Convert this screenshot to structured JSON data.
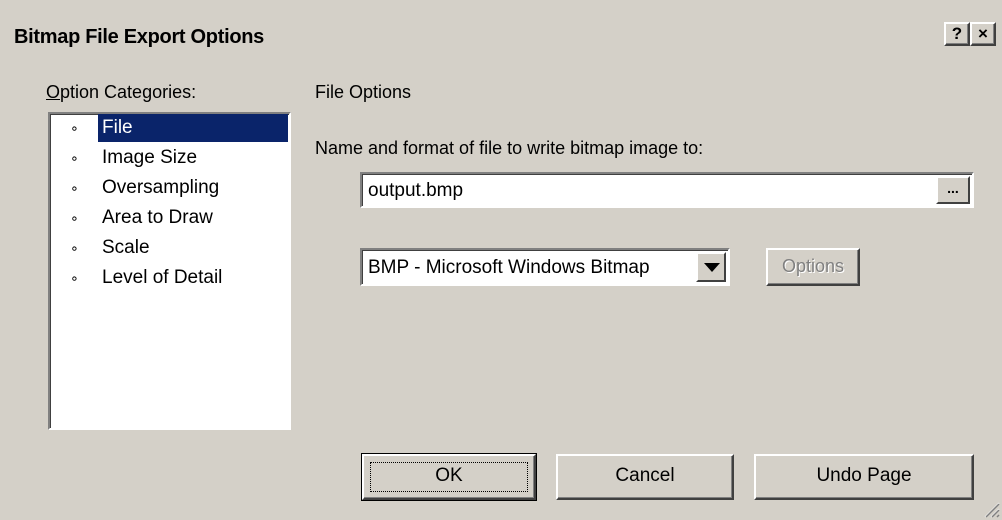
{
  "window": {
    "title": "Bitmap File Export Options",
    "help_button": "?",
    "close_button": "×"
  },
  "categories": {
    "label_accel": "O",
    "label_rest": "ption Categories:",
    "items": [
      {
        "bullet": "∘",
        "label": "File",
        "selected": true
      },
      {
        "bullet": "∘",
        "label": "Image Size",
        "selected": false
      },
      {
        "bullet": "∘",
        "label": "Oversampling",
        "selected": false
      },
      {
        "bullet": "∘",
        "label": "Area to Draw",
        "selected": false
      },
      {
        "bullet": "∘",
        "label": "Scale",
        "selected": false
      },
      {
        "bullet": "∘",
        "label": "Level of Detail",
        "selected": false
      }
    ]
  },
  "file_options": {
    "section_title": "File Options",
    "name_label": "Name and format of file to write bitmap image to:",
    "filename": "output.bmp",
    "browse_label": "...",
    "format_selected": "BMP - Microsoft Windows Bitmap",
    "options_label": "Options"
  },
  "buttons": {
    "ok": "OK",
    "cancel": "Cancel",
    "undo_page": "Undo Page"
  },
  "colors": {
    "face": "#d4d0c8",
    "selection": "#0a246a",
    "disabled_text": "#808080"
  }
}
